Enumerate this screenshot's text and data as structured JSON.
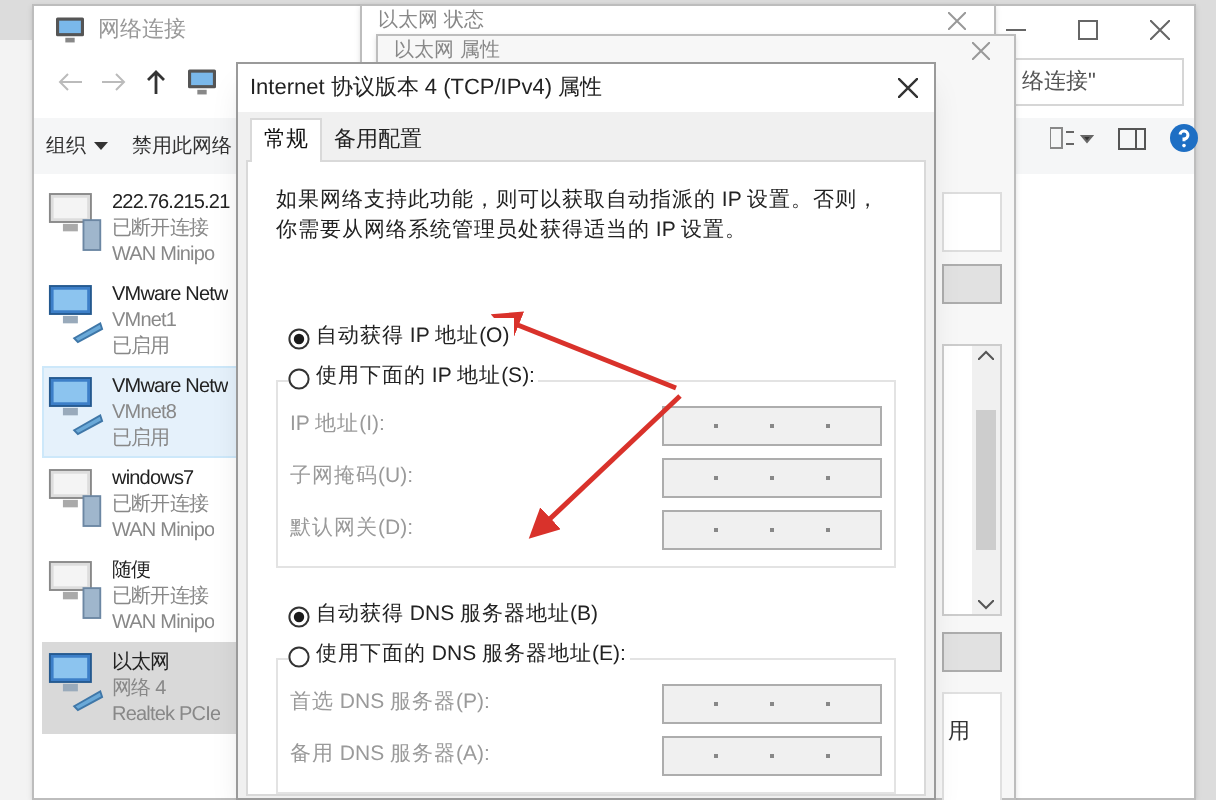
{
  "explorer": {
    "title": "网络连接",
    "search_value": "络连接\"",
    "toolbar": [
      {
        "label": "组织",
        "menu": true
      },
      {
        "label": "禁用此网络",
        "menu": false
      }
    ]
  },
  "connections": [
    {
      "name": "222.76.215.21",
      "status": "已断开连接",
      "device": "WAN Minipo",
      "kind": "wan",
      "selected": false,
      "hovered": false
    },
    {
      "name": "VMware Netw",
      "status": "VMnet1",
      "device": "已启用",
      "kind": "lan",
      "selected": false,
      "hovered": false
    },
    {
      "name": "VMware Netw",
      "status": "VMnet8",
      "device": "已启用",
      "kind": "lan",
      "selected": false,
      "hovered": true
    },
    {
      "name": "windows7",
      "status": "已断开连接",
      "device": "WAN Minipo",
      "kind": "wan",
      "selected": false,
      "hovered": false
    },
    {
      "name": "随便",
      "status": "已断开连接",
      "device": "WAN Minipo",
      "kind": "wan",
      "selected": false,
      "hovered": false
    },
    {
      "name": "以太网",
      "status": "网络 4",
      "device": "Realtek PCIe",
      "kind": "lan",
      "selected": true,
      "hovered": false
    }
  ],
  "status_window": {
    "title": "以太网 状态"
  },
  "properties_window": {
    "title": "以太网 属性",
    "button_fragment": "用"
  },
  "dialog": {
    "title": "Internet 协议版本 4 (TCP/IPv4) 属性",
    "tabs": [
      {
        "label": "常规",
        "selected": true
      },
      {
        "label": "备用配置",
        "selected": false
      }
    ],
    "description": "如果网络支持此功能，则可以获取自动指派的 IP 设置。否则，你需要从网络系统管理员处获得适当的 IP 设置。",
    "ip_options": [
      {
        "label": "自动获得 IP 地址(O)",
        "selected": true
      },
      {
        "label": "使用下面的 IP 地址(S):",
        "selected": false
      }
    ],
    "ip_fields": {
      "disabled": true,
      "fields": [
        {
          "label": "IP 地址(I):"
        },
        {
          "label": "子网掩码(U):"
        },
        {
          "label": "默认网关(D):"
        }
      ]
    },
    "dns_options": [
      {
        "label": "自动获得 DNS 服务器地址(B)",
        "selected": true
      },
      {
        "label": "使用下面的 DNS 服务器地址(E):",
        "selected": false
      }
    ],
    "dns_fields": {
      "disabled": true,
      "fields": [
        {
          "label": "首选 DNS 服务器(P):"
        },
        {
          "label": "备用 DNS 服务器(A):"
        }
      ]
    }
  }
}
